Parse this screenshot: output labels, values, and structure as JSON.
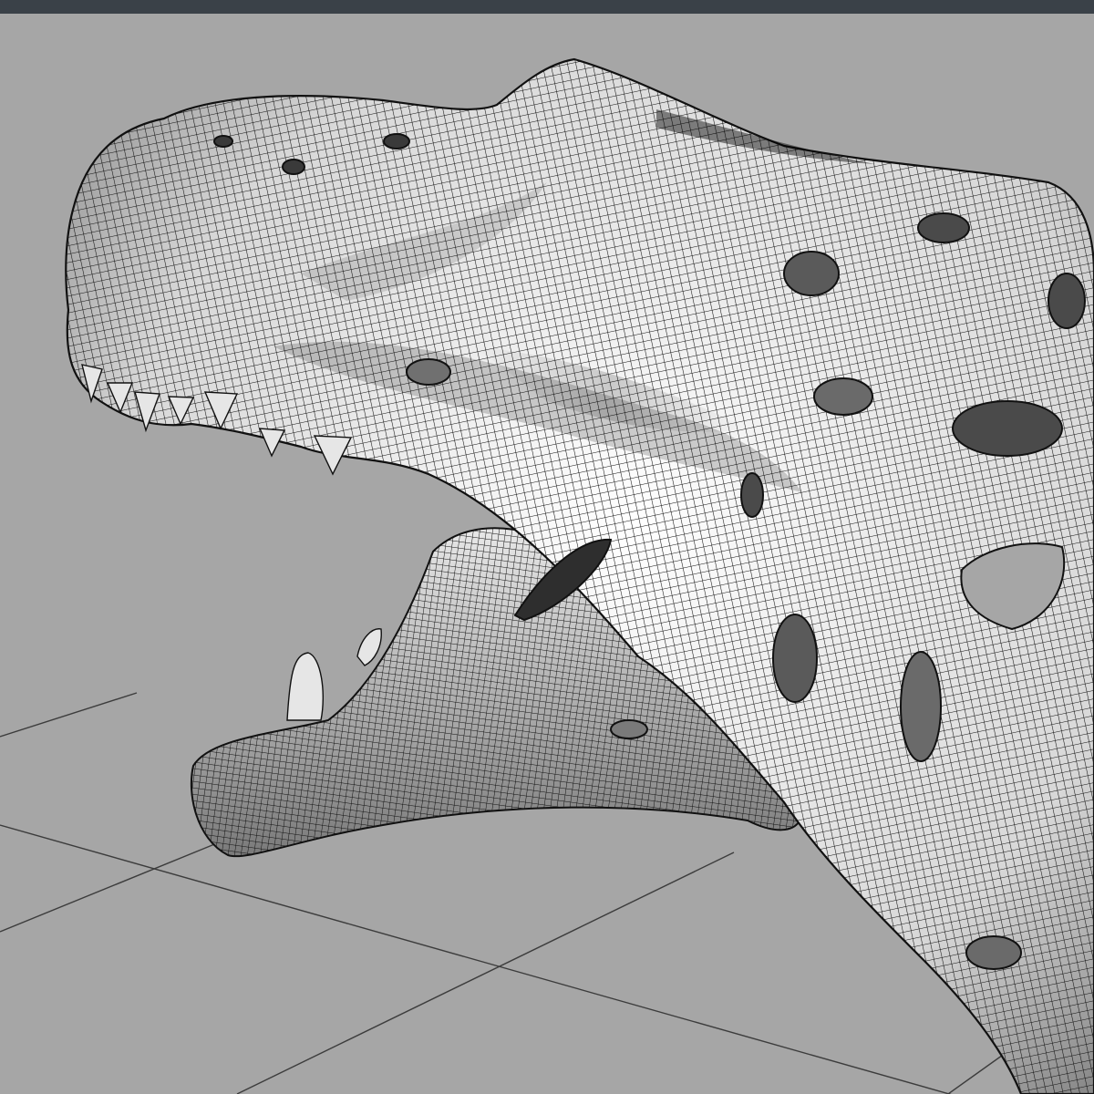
{
  "viewport": {
    "background_color": "#a6a6a6",
    "grid_color": "#3c3c3c",
    "mesh_fill_color": "#ffffff",
    "mesh_wire_color": "#111111",
    "shading_color": "#5a5a5a",
    "display_mode": "wireframe-on-shaded",
    "object": "t-rex-skull-mesh"
  },
  "titlebar": {
    "color": "#3a4148"
  }
}
